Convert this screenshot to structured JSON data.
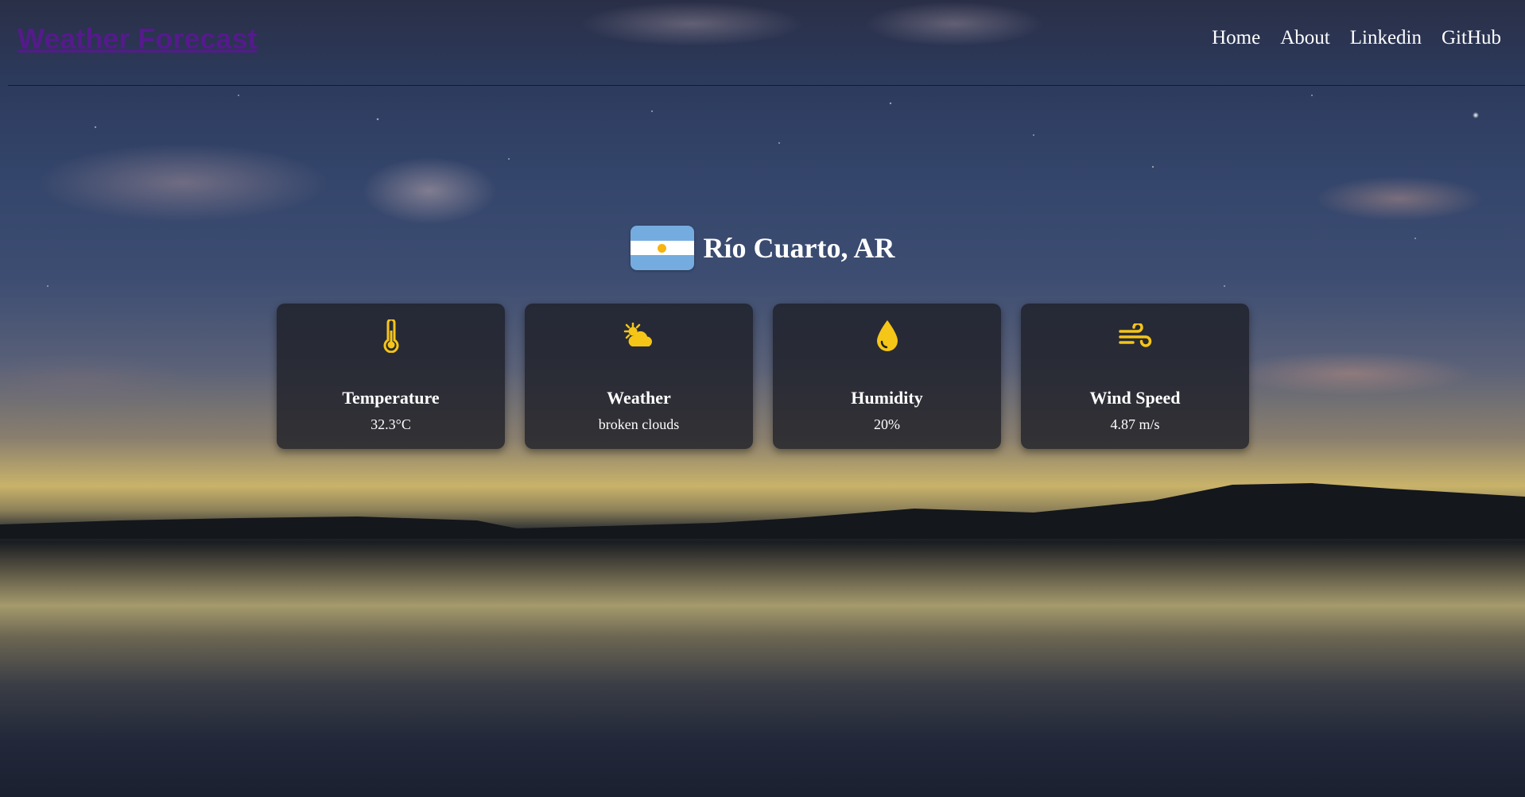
{
  "header": {
    "brand": "Weather Forecast",
    "nav": [
      {
        "label": "Home"
      },
      {
        "label": "About"
      },
      {
        "label": "Linkedin"
      },
      {
        "label": "GitHub"
      }
    ]
  },
  "location": {
    "flag_icon": "argentina-flag-icon",
    "name": "Río Cuarto, AR"
  },
  "cards": [
    {
      "icon": "thermometer-icon",
      "label": "Temperature",
      "value": "32.3°C"
    },
    {
      "icon": "sun-behind-cloud-icon",
      "label": "Weather",
      "value": "broken clouds"
    },
    {
      "icon": "water-drop-icon",
      "label": "Humidity",
      "value": "20%"
    },
    {
      "icon": "wind-icon",
      "label": "Wind Speed",
      "value": "4.87 m/s"
    }
  ],
  "colors": {
    "accent_icon": "#f5c518",
    "brand_link": "#551a8b",
    "card_bg": "#1e2028",
    "text": "#ffffff"
  }
}
